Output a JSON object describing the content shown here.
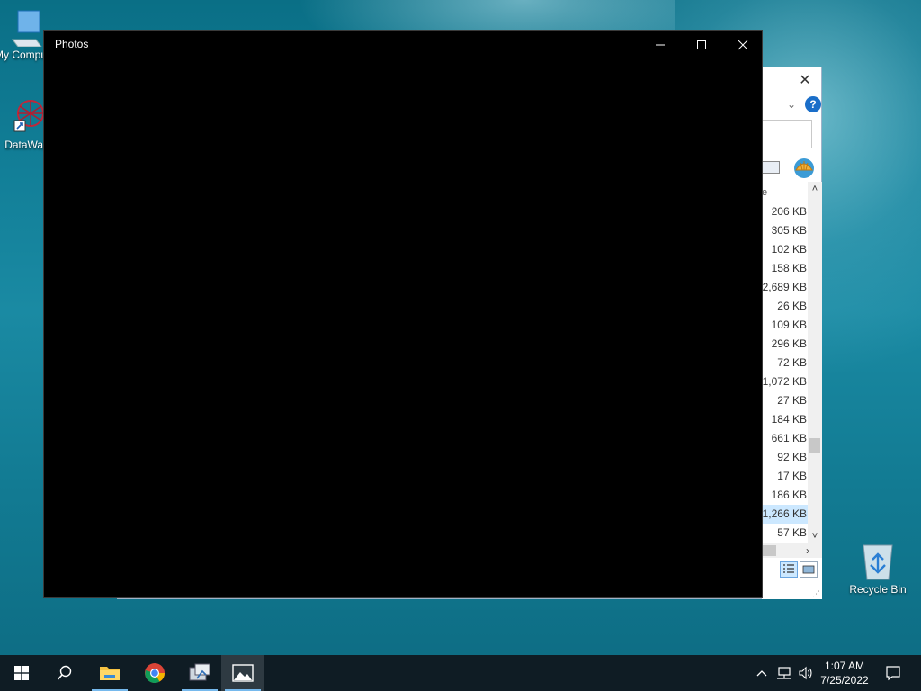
{
  "desktop": {
    "icons": [
      {
        "label": "My Computer",
        "icon": "computer-icon"
      },
      {
        "label": "DataWag",
        "icon": "datawag-icon"
      },
      {
        "label": "Recycle Bin",
        "icon": "recycle-bin-icon"
      }
    ]
  },
  "photos_window": {
    "title": "Photos",
    "minimize_glyph": "—",
    "maximize_glyph": "□",
    "close_glyph": "✕"
  },
  "explorer_window": {
    "close_glyph": "✕",
    "help_glyph": "?",
    "chevron_glyph": "⌄",
    "column_header_fragment": "e",
    "file_sizes": [
      "206 KB",
      "305 KB",
      "102 KB",
      "158 KB",
      "2,689 KB",
      "26 KB",
      "109 KB",
      "296 KB",
      "72 KB",
      "1,072 KB",
      "27 KB",
      "184 KB",
      "661 KB",
      "92 KB",
      "17 KB",
      "186 KB",
      "1,266 KB",
      "57 KB"
    ],
    "selected_row_index": 16
  },
  "taskbar": {
    "apps": [
      "start-button",
      "search-button",
      "file-explorer",
      "chrome",
      "setup-wizard",
      "photos"
    ],
    "active_app": "photos",
    "clock_time": "1:07 AM",
    "clock_date": "7/25/2022"
  },
  "colors": {
    "taskbar_bg": "#0f1c24",
    "active_underline": "#76b9ed",
    "selection": "#cce8ff"
  }
}
